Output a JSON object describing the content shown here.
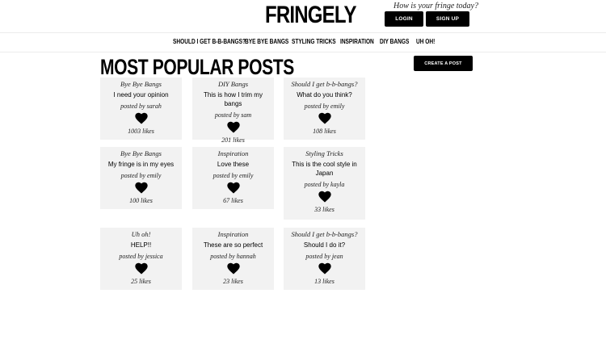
{
  "header": {
    "logo": "FRINGELY",
    "tagline": "How is your fringe today?",
    "login_label": "LOGIN",
    "signup_label": "SIGN UP"
  },
  "nav": {
    "items": [
      {
        "label": "SHOULD I GET B-B-BANGS?"
      },
      {
        "label": "BYE BYE BANGS"
      },
      {
        "label": "STYLING TRICKS"
      },
      {
        "label": "INSPIRATION"
      },
      {
        "label": "DIY BANGS"
      },
      {
        "label": "UH OH!"
      }
    ]
  },
  "main": {
    "title": "MOST POPULAR POSTS",
    "create_label": "CREATE A POST",
    "posts": [
      {
        "category": "Bye Bye Bangs",
        "title": "I need your opinion",
        "author": "posted by sarah",
        "likes": "1003 likes"
      },
      {
        "category": "DIY Bangs",
        "title": "This is how I trim my bangs",
        "author": "posted by sam",
        "likes": "201 likes"
      },
      {
        "category": "Should I get b-b-bangs?",
        "title": "What do you think?",
        "author": "posted by emily",
        "likes": "108 likes"
      },
      {
        "category": "Bye Bye Bangs",
        "title": "My fringe is in my eyes",
        "author": "posted by emily",
        "likes": "100 likes"
      },
      {
        "category": "Inspiration",
        "title": "Love these",
        "author": "posted by emily",
        "likes": "67 likes"
      },
      {
        "category": "Styling Tricks",
        "title": "This is the cool style in Japan",
        "author": "posted by kayla",
        "likes": "33 likes"
      },
      {
        "category": "Uh oh!",
        "title": "HELP!!",
        "author": "posted by jessica",
        "likes": "25 likes"
      },
      {
        "category": "Inspiration",
        "title": "These are so perfect",
        "author": "posted by hannah",
        "likes": "23 likes"
      },
      {
        "category": "Should I get b-b-bangs?",
        "title": "Should I do it?",
        "author": "posted by jean",
        "likes": "13 likes"
      }
    ]
  },
  "icons": {
    "heart": "heart-icon"
  },
  "colors": {
    "accent": "#000000",
    "card_bg": "#f2f2f2",
    "divider": "#ececec"
  }
}
